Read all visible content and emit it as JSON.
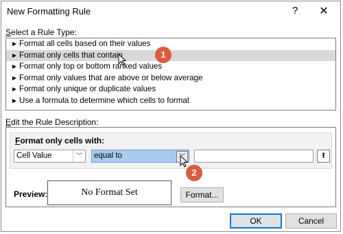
{
  "window": {
    "title": "New Formatting Rule",
    "help_icon": "?",
    "close_icon": "✕"
  },
  "rule_type": {
    "label_prefix": "",
    "label_accel": "S",
    "label_rest": "elect a Rule Type:",
    "items": [
      {
        "label": "Format all cells based on their values"
      },
      {
        "label": "Format only cells that contain"
      },
      {
        "label": "Format only top or bottom ranked values"
      },
      {
        "label": "Format only values that are above or below average"
      },
      {
        "label": "Format only unique or duplicate values"
      },
      {
        "label": "Use a formula to determine which cells to format"
      }
    ],
    "selected_index": 1
  },
  "description": {
    "label_accel": "E",
    "label_rest": "dit the Rule Description:",
    "format_only_accel": "F",
    "format_only_rest": "ormat only cells with:",
    "cell_value": "Cell Value",
    "operator": "equal to",
    "value": "",
    "ref_button_icon": "range-select-icon"
  },
  "preview": {
    "label": "Preview:",
    "text": "No Format Set",
    "format_button": "Format..."
  },
  "buttons": {
    "ok": "OK",
    "cancel": "Cancel"
  },
  "callouts": [
    {
      "number": "1"
    },
    {
      "number": "2"
    }
  ],
  "colors": {
    "marker": "#d95c3f",
    "highlight": "#a9cbef",
    "selected_row": "#d9d9d9"
  }
}
